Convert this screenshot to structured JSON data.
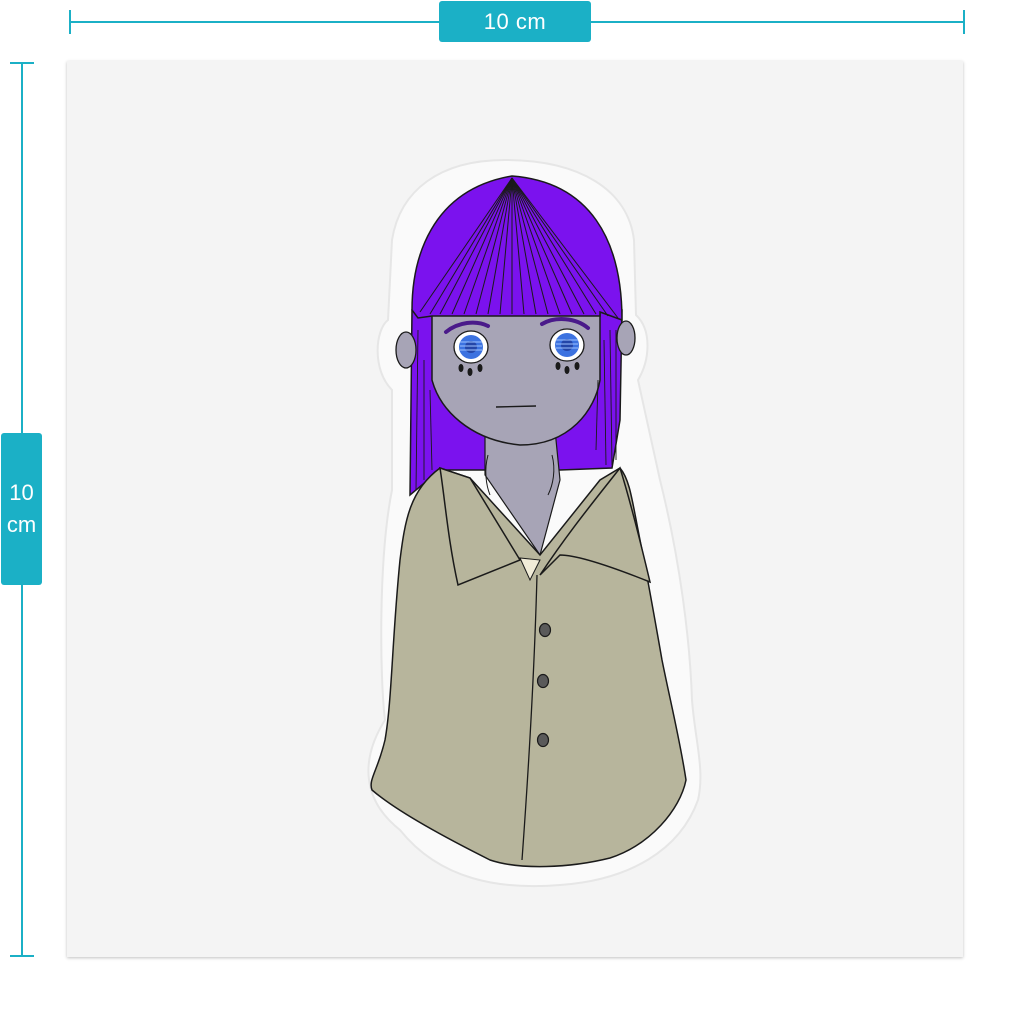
{
  "dimensions": {
    "width_label": "10 cm",
    "height_value": "10",
    "height_unit": "cm"
  },
  "sticker": {
    "subject": "girl-with-purple-hair-illustration",
    "colors": {
      "accent": "#1bb0c6",
      "sheet": "#f4f4f4",
      "hair": "#7b12ee",
      "skin": "#a7a4b6",
      "shirt": "#b7b59c",
      "eyes": "#3c72e0",
      "outline": "#1a1a1a"
    }
  }
}
